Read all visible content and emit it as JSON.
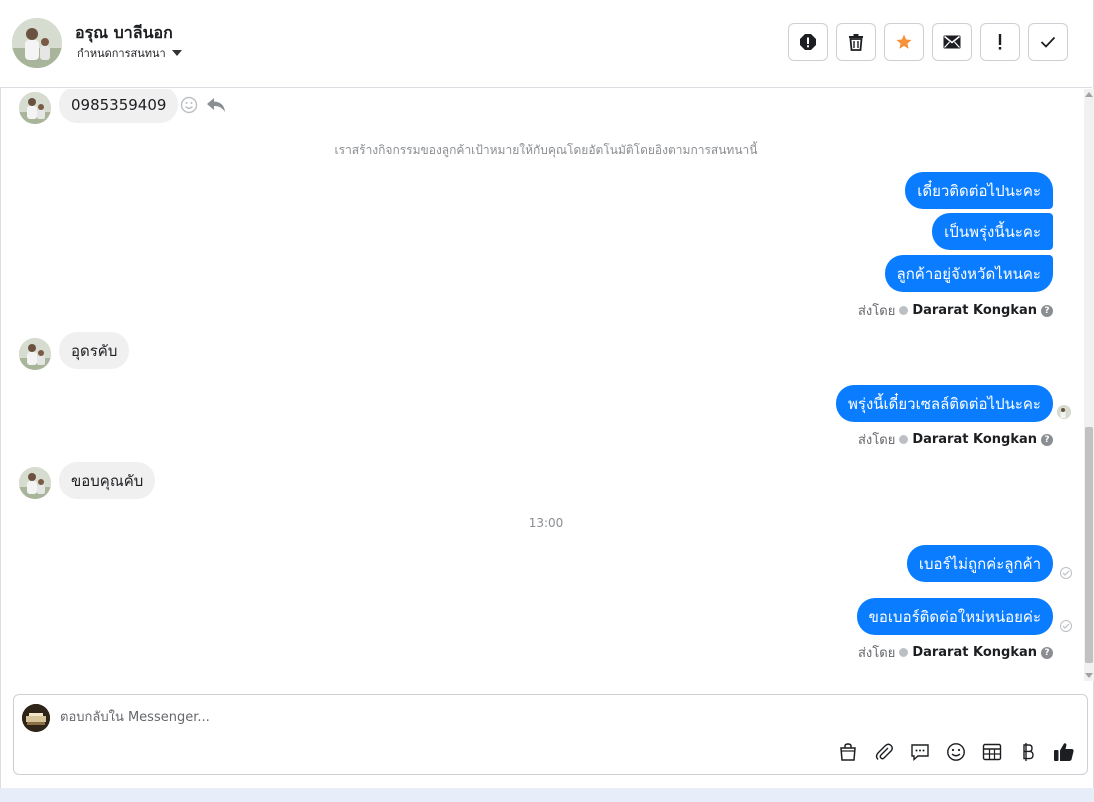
{
  "header": {
    "contact_name": "อรุณ บาลีนอก",
    "conversation_setting_label": "กำหนดการสนทนา",
    "actions": [
      "report-icon",
      "trash-icon",
      "star-icon",
      "envelope-icon",
      "exclamation-icon",
      "check-icon"
    ],
    "star_color": "#f7923b"
  },
  "thread": {
    "messages": [
      {
        "direction": "in",
        "text": "0985359409"
      },
      {
        "direction": "system",
        "text": "เราสร้างกิจกรรมของลูกค้าเป้าหมายให้กับคุณโดยอัตโนมัติโดยอิงตามการสนทนานี้"
      },
      {
        "direction": "out",
        "text": "เดี๋ยวติดต่อไปนะคะ"
      },
      {
        "direction": "out",
        "text": "เป็นพรุ่งนี้นะคะ"
      },
      {
        "direction": "out",
        "text": "ลูกค้าอยู่จังหวัดไหนคะ"
      },
      {
        "direction": "sent_by",
        "label": "ส่งโดย",
        "agent": "Dararat Kongkan",
        "help": "?"
      },
      {
        "direction": "in",
        "text": "อุดรคับ"
      },
      {
        "direction": "out",
        "text": "พรุ่งนี้เดี๋ยวเซลล์ติดต่อไปนะคะ"
      },
      {
        "direction": "sent_by",
        "label": "ส่งโดย",
        "agent": "Dararat Kongkan",
        "help": "?"
      },
      {
        "direction": "in",
        "text": "ขอบคุณคับ"
      },
      {
        "direction": "timestamp",
        "text": "13:00"
      },
      {
        "direction": "out",
        "text": "เบอร์ไม่ถูกค่ะลูกค้า"
      },
      {
        "direction": "out",
        "text": "ขอเบอร์ติดต่อใหม่หน่อยค่ะ"
      },
      {
        "direction": "sent_by",
        "label": "ส่งโดย",
        "agent": "Dararat Kongkan",
        "help": "?"
      }
    ],
    "outgoing_color": "#0a7cff",
    "incoming_color": "#f0f0f0"
  },
  "composer": {
    "placeholder": "ตอบกลับใน Messenger...",
    "tools": [
      "shopping-bag-icon",
      "paperclip-icon",
      "saved-replies-icon",
      "emoji-icon",
      "calendar-table-icon",
      "baht-icon",
      "thumbs-up-icon"
    ]
  }
}
